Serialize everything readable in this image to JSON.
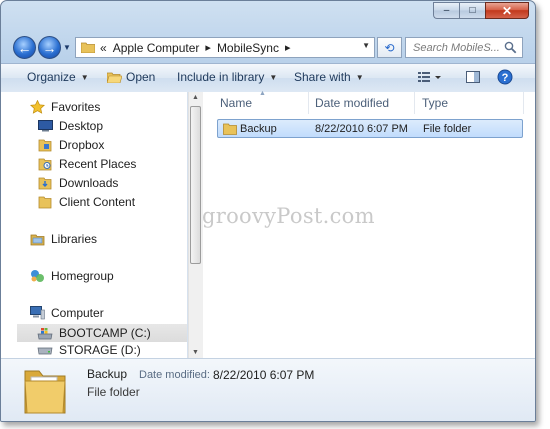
{
  "window": {
    "caption_buttons": {
      "minimize": "–",
      "maximize": "□",
      "close": "✕"
    }
  },
  "nav": {
    "breadcrumb_overflow": "«",
    "breadcrumbs": [
      "Apple Computer",
      "MobileSync"
    ],
    "search_placeholder": "Search MobileS..."
  },
  "toolbar": {
    "organize": "Organize",
    "open": "Open",
    "include_in_library": "Include in library",
    "share_with": "Share with"
  },
  "sidebar": {
    "favorites_label": "Favorites",
    "favorites": [
      "Desktop",
      "Dropbox",
      "Recent Places",
      "Downloads",
      "Client Content"
    ],
    "libraries_label": "Libraries",
    "homegroup_label": "Homegroup",
    "computer_label": "Computer",
    "drives": [
      "BOOTCAMP (C:)",
      "STORAGE (D:)"
    ]
  },
  "columns": {
    "name": "Name",
    "date_modified": "Date modified",
    "type": "Type"
  },
  "files": [
    {
      "name": "Backup",
      "date_modified": "8/22/2010 6:07 PM",
      "type": "File folder"
    }
  ],
  "watermark": "groovyPost.com",
  "details": {
    "name": "Backup",
    "type": "File folder",
    "date_label": "Date modified:",
    "date_value": "8/22/2010 6:07 PM"
  },
  "colors": {
    "accent": "#2a6fd1",
    "selection": "#c1dcfc",
    "folder": "#e8c25a"
  }
}
